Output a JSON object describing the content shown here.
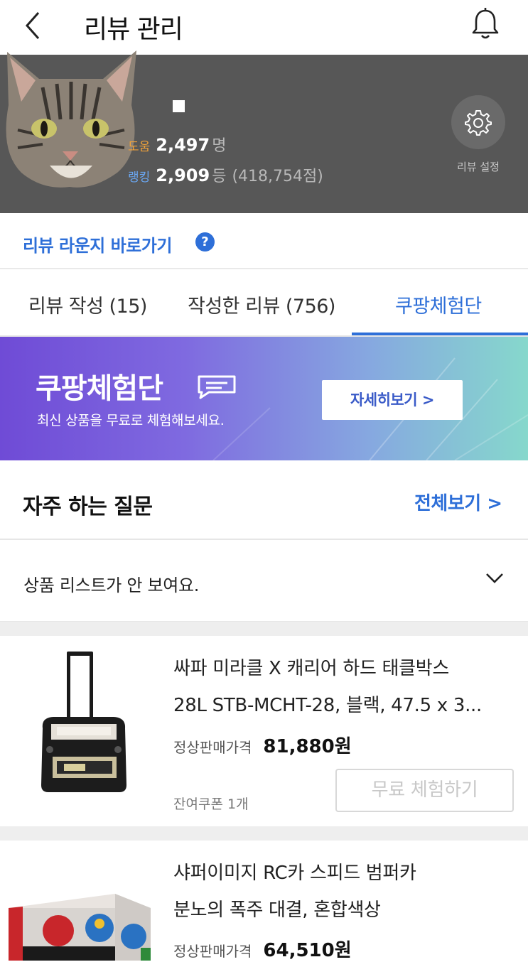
{
  "header": {
    "title": "리뷰 관리"
  },
  "profile": {
    "help_label": "도움",
    "help_count": "2,497",
    "help_unit": "명",
    "rank_label": "랭킹",
    "rank_value": "2,909",
    "rank_unit": "등",
    "points": "(418,754점)",
    "settings_label": "리뷰 설정"
  },
  "lounge": {
    "label": "리뷰 라운지 바로가기",
    "help_icon": "?"
  },
  "tabs": [
    {
      "label": "리뷰 작성 (15)",
      "active": false
    },
    {
      "label": "작성한 리뷰 (756)",
      "active": false
    },
    {
      "label": "쿠팡체험단",
      "active": true
    }
  ],
  "banner": {
    "title": "쿠팡체험단",
    "subtitle": "최신 상품을 무료로 체험해보세요.",
    "button": "자세히보기 >",
    "colors": {
      "start": "#6f4bd6",
      "end": "#86d8cc"
    }
  },
  "faq": {
    "title": "자주 하는 질문",
    "view_all": "전체보기 >",
    "items": [
      {
        "question": "상품 리스트가 안 보여요."
      }
    ]
  },
  "products": [
    {
      "name_line1": "싸파 미라클 X 캐리어 하드 태클박스",
      "name_line2": "28L STB-MCHT-28, 블랙, 47.5 x 3...",
      "price_label": "정상판매가격",
      "price": "81,880원",
      "coupon": "잔여쿠폰 1개",
      "button": "무료 체험하기"
    },
    {
      "name_line1": "샤퍼이미지 RC카 스피드 범퍼카",
      "name_line2": "분노의 폭주 대결, 혼합색상",
      "price_label": "정상판매가격",
      "price": "64,510원"
    }
  ],
  "icons": [
    "back-arrow-icon",
    "bell-icon",
    "gear-icon",
    "question-icon",
    "chat-bubble-icon",
    "chevron-down-icon"
  ],
  "accent_color": "#2e6fd8"
}
